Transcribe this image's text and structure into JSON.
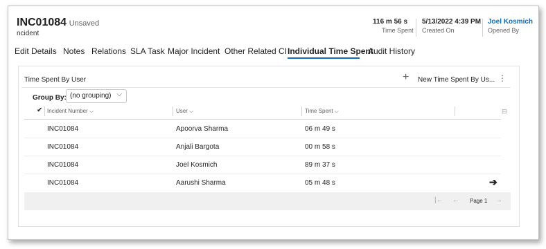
{
  "record": {
    "title": "INC01084",
    "state": "- Unsaved",
    "entity": "ncident"
  },
  "header_fields": [
    {
      "value": "116 m 56 s",
      "label": "Time Spent"
    },
    {
      "value": "5/13/2022 4:39 PM",
      "label": "Created On"
    },
    {
      "value": "Joel Kosmich",
      "label": "Opened By"
    }
  ],
  "tabs": [
    {
      "label": "Edit Details"
    },
    {
      "label": "Notes"
    },
    {
      "label": "Relations"
    },
    {
      "label": "SLA Task"
    },
    {
      "label": "Major Incident"
    },
    {
      "label": "Other Related CI"
    },
    {
      "label": "Individual Time Spent",
      "active": true
    },
    {
      "label": "Audit History"
    }
  ],
  "subgrid": {
    "title": "Time Spent By User",
    "new_button": "New Time Spent By Us...",
    "group_by_label": "Group By:",
    "group_by_value": "(no grouping)",
    "columns": [
      "Incident Number",
      "User",
      "Time Spent"
    ],
    "rows": [
      {
        "incident": "INC01084",
        "user": "Apoorva Sharma",
        "time": "06 m 49 s"
      },
      {
        "incident": "INC01084",
        "user": "Anjali Bargota",
        "time": "00 m 58 s"
      },
      {
        "incident": "INC01084",
        "user": "Joel Kosmich",
        "time": "89 m 37 s"
      },
      {
        "incident": "INC01084",
        "user": "Aarushi Sharma",
        "time": "05 m 48 s"
      }
    ],
    "page_label": "Page 1"
  },
  "icons": {
    "add": "plus-icon",
    "more": "more-vertical-icon",
    "sort": "chevron-down-icon",
    "select_all": "checkmark-icon",
    "open_row": "arrow-right-icon",
    "first_page": "first-page-icon",
    "prev_page": "previous-page-icon",
    "next_page": "next-page-icon"
  },
  "colors": {
    "accent": "#0f6cbd",
    "footer_bg": "#f0f0f0"
  }
}
